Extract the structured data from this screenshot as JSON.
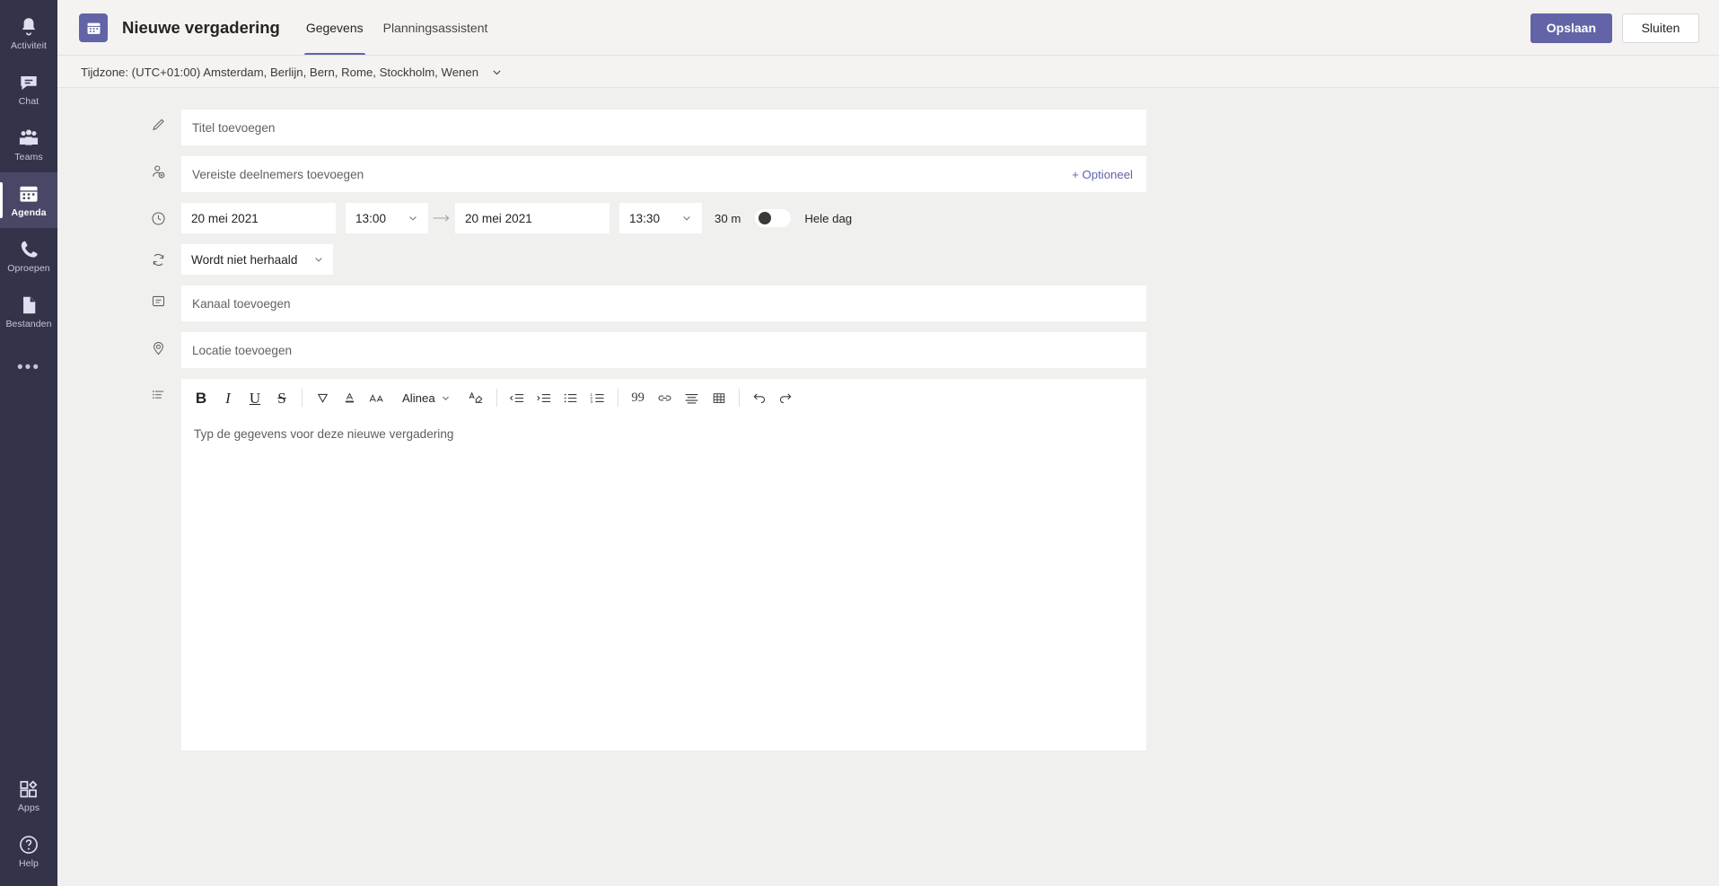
{
  "rail": {
    "items": [
      {
        "label": "Activiteit",
        "icon": "bell-icon",
        "active": false
      },
      {
        "label": "Chat",
        "icon": "chat-icon",
        "active": false
      },
      {
        "label": "Teams",
        "icon": "teams-icon",
        "active": false
      },
      {
        "label": "Agenda",
        "icon": "calendar-icon",
        "active": true
      },
      {
        "label": "Oproepen",
        "icon": "phone-icon",
        "active": false
      },
      {
        "label": "Bestanden",
        "icon": "files-icon",
        "active": false
      }
    ],
    "more": "•••",
    "bottom": [
      {
        "label": "Apps",
        "icon": "apps-icon"
      },
      {
        "label": "Help",
        "icon": "help-icon"
      }
    ]
  },
  "header": {
    "badge_icon": "calendar-icon",
    "title": "Nieuwe vergadering",
    "tabs": [
      {
        "label": "Gegevens",
        "active": true
      },
      {
        "label": "Planningsassistent",
        "active": false
      }
    ],
    "save_label": "Opslaan",
    "close_label": "Sluiten"
  },
  "timezone": {
    "label": "Tijdzone: (UTC+01:00) Amsterdam, Berlijn, Bern, Rome, Stockholm, Wenen",
    "caret_icon": "chevron-down-icon"
  },
  "form": {
    "title_field": {
      "icon": "pencil-icon",
      "placeholder": "Titel toevoegen",
      "value": ""
    },
    "attendees_field": {
      "icon": "add-person-icon",
      "placeholder": "Vereiste deelnemers toevoegen",
      "value": "",
      "optional_label": "+ Optioneel"
    },
    "datetime": {
      "icon": "clock-icon",
      "start_date": "20 mei 2021",
      "start_time": "13:00",
      "arrow_icon": "arrow-right-icon",
      "end_date": "20 mei 2021",
      "end_time": "13:30",
      "duration": "30 m",
      "allday_label": "Hele dag",
      "allday_on": false,
      "caret_icon": "chevron-down-icon"
    },
    "recurrence": {
      "icon": "repeat-icon",
      "value": "Wordt niet herhaald",
      "caret_icon": "chevron-down-icon"
    },
    "channel_field": {
      "icon": "channel-icon",
      "placeholder": "Kanaal toevoegen",
      "value": ""
    },
    "location_field": {
      "icon": "location-pin-icon",
      "placeholder": "Locatie toevoegen",
      "value": ""
    },
    "details": {
      "icon": "details-list-icon",
      "placeholder": "Typ de gegevens voor deze nieuwe vergadering",
      "value": "",
      "toolbar": {
        "bold": "B",
        "italic": "I",
        "underline": "U",
        "strikethrough": "S",
        "highlight_icon": "highlight-icon",
        "font_color_icon": "font-color-icon",
        "font_size_icon": "font-size-icon",
        "paragraph_label": "Alinea",
        "clear_format_icon": "clear-formatting-icon",
        "decrease_indent_icon": "decrease-indent-icon",
        "increase_indent_icon": "increase-indent-icon",
        "bullet_list_icon": "bullet-list-icon",
        "numbered_list_icon": "numbered-list-icon",
        "quote_label": "99",
        "link_icon": "link-icon",
        "align_icon": "align-icon",
        "table_icon": "table-icon",
        "undo_icon": "undo-icon",
        "redo_icon": "redo-icon"
      }
    }
  },
  "colors": {
    "brand": "#6264a7",
    "rail_bg": "#33344a",
    "rail_active": "#484766",
    "canvas": "#f0f0ef",
    "header_bg": "#f4f3f2",
    "field_bg": "#ffffff",
    "text": "#252423",
    "placeholder": "#616161"
  }
}
